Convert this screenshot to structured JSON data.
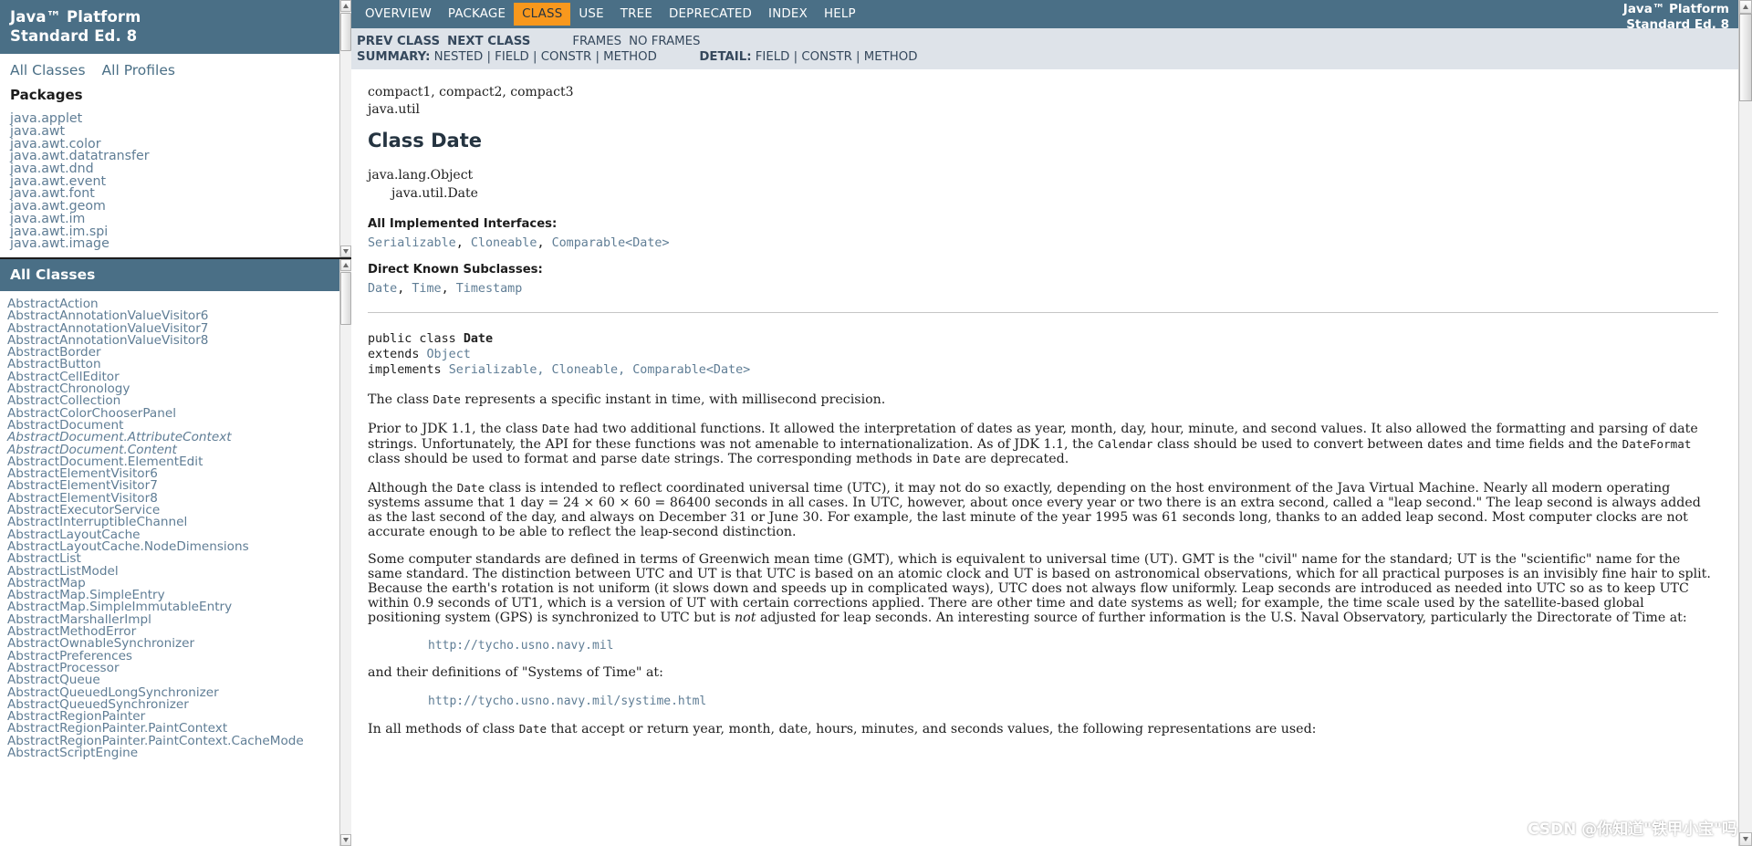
{
  "window": {
    "brand_line1": "Java™ Platform",
    "brand_line2": "Standard Ed. 8"
  },
  "package_frame": {
    "links": [
      {
        "label": "All Classes"
      },
      {
        "label": "All Profiles"
      }
    ],
    "section_title": "Packages",
    "packages": [
      "java.applet",
      "java.awt",
      "java.awt.color",
      "java.awt.datatransfer",
      "java.awt.dnd",
      "java.awt.event",
      "java.awt.font",
      "java.awt.geom",
      "java.awt.im",
      "java.awt.im.spi",
      "java.awt.image"
    ]
  },
  "class_frame": {
    "header": "All Classes",
    "classes": [
      {
        "name": "AbstractAction",
        "interface": false
      },
      {
        "name": "AbstractAnnotationValueVisitor6",
        "interface": false
      },
      {
        "name": "AbstractAnnotationValueVisitor7",
        "interface": false
      },
      {
        "name": "AbstractAnnotationValueVisitor8",
        "interface": false
      },
      {
        "name": "AbstractBorder",
        "interface": false
      },
      {
        "name": "AbstractButton",
        "interface": false
      },
      {
        "name": "AbstractCellEditor",
        "interface": false
      },
      {
        "name": "AbstractChronology",
        "interface": false
      },
      {
        "name": "AbstractCollection",
        "interface": false
      },
      {
        "name": "AbstractColorChooserPanel",
        "interface": false
      },
      {
        "name": "AbstractDocument",
        "interface": false
      },
      {
        "name": "AbstractDocument.AttributeContext",
        "interface": true
      },
      {
        "name": "AbstractDocument.Content",
        "interface": true
      },
      {
        "name": "AbstractDocument.ElementEdit",
        "interface": false
      },
      {
        "name": "AbstractElementVisitor6",
        "interface": false
      },
      {
        "name": "AbstractElementVisitor7",
        "interface": false
      },
      {
        "name": "AbstractElementVisitor8",
        "interface": false
      },
      {
        "name": "AbstractExecutorService",
        "interface": false
      },
      {
        "name": "AbstractInterruptibleChannel",
        "interface": false
      },
      {
        "name": "AbstractLayoutCache",
        "interface": false
      },
      {
        "name": "AbstractLayoutCache.NodeDimensions",
        "interface": false
      },
      {
        "name": "AbstractList",
        "interface": false
      },
      {
        "name": "AbstractListModel",
        "interface": false
      },
      {
        "name": "AbstractMap",
        "interface": false
      },
      {
        "name": "AbstractMap.SimpleEntry",
        "interface": false
      },
      {
        "name": "AbstractMap.SimpleImmutableEntry",
        "interface": false
      },
      {
        "name": "AbstractMarshallerImpl",
        "interface": false
      },
      {
        "name": "AbstractMethodError",
        "interface": false
      },
      {
        "name": "AbstractOwnableSynchronizer",
        "interface": false
      },
      {
        "name": "AbstractPreferences",
        "interface": false
      },
      {
        "name": "AbstractProcessor",
        "interface": false
      },
      {
        "name": "AbstractQueue",
        "interface": false
      },
      {
        "name": "AbstractQueuedLongSynchronizer",
        "interface": false
      },
      {
        "name": "AbstractQueuedSynchronizer",
        "interface": false
      },
      {
        "name": "AbstractRegionPainter",
        "interface": false
      },
      {
        "name": "AbstractRegionPainter.PaintContext",
        "interface": false
      },
      {
        "name": "AbstractRegionPainter.PaintContext.CacheMode",
        "interface": false
      },
      {
        "name": "AbstractScriptEngine",
        "interface": false
      }
    ]
  },
  "topnav": {
    "items": [
      {
        "label": "OVERVIEW",
        "active": false
      },
      {
        "label": "PACKAGE",
        "active": false
      },
      {
        "label": "CLASS",
        "active": true
      },
      {
        "label": "USE",
        "active": false
      },
      {
        "label": "TREE",
        "active": false
      },
      {
        "label": "DEPRECATED",
        "active": false
      },
      {
        "label": "INDEX",
        "active": false
      },
      {
        "label": "HELP",
        "active": false
      }
    ],
    "about_line1": "Java™ Platform",
    "about_line2": "Standard Ed. 8",
    "active_color": "#f8981d",
    "bar_color": "#4a6f86"
  },
  "subnav": {
    "prev_class": "PREV CLASS",
    "next_class": "NEXT CLASS",
    "frames": "FRAMES",
    "no_frames": "NO FRAMES",
    "summary_label": "SUMMARY:",
    "summary_items": [
      "NESTED",
      "FIELD",
      "CONSTR",
      "METHOD"
    ],
    "detail_label": "DETAIL:",
    "detail_items": [
      "FIELD",
      "CONSTR",
      "METHOD"
    ],
    "separator": "|"
  },
  "content": {
    "profiles": "compact1, compact2, compact3",
    "package": "java.util",
    "title": "Class Date",
    "inheritance": [
      "java.lang.Object",
      "java.util.Date"
    ],
    "implemented_label": "All Implemented Interfaces:",
    "implemented": [
      "Serializable",
      "Cloneable",
      "Comparable<Date>"
    ],
    "subclasses_label": "Direct Known Subclasses:",
    "subclasses": [
      "Date",
      "Time",
      "Timestamp"
    ],
    "declaration": {
      "line1_kw": "public class",
      "line1_name": "Date",
      "line2_kw": "extends",
      "line2_type": "Object",
      "line3_kw": "implements",
      "line3_types": "Serializable, Cloneable, Comparable<Date>"
    },
    "paragraphs": [
      "The class Date represents a specific instant in time, with millisecond precision.",
      "Prior to JDK 1.1, the class Date had two additional functions. It allowed the interpretation of dates as year, month, day, hour, minute, and second values. It also allowed the formatting and parsing of date strings. Unfortunately, the API for these functions was not amenable to internationalization. As of JDK 1.1, the Calendar class should be used to convert between dates and time fields and the DateFormat class should be used to format and parse date strings. The corresponding methods in Date are deprecated.",
      "Although the Date class is intended to reflect coordinated universal time (UTC), it may not do so exactly, depending on the host environment of the Java Virtual Machine. Nearly all modern operating systems assume that 1 day = 24 × 60 × 60 = 86400 seconds in all cases. In UTC, however, about once every year or two there is an extra second, called a \"leap second.\" The leap second is always added as the last second of the day, and always on December 31 or June 30. For example, the last minute of the year 1995 was 61 seconds long, thanks to an added leap second. Most computer clocks are not accurate enough to be able to reflect the leap-second distinction.",
      "Some computer standards are defined in terms of Greenwich mean time (GMT), which is equivalent to universal time (UT). GMT is the \"civil\" name for the standard; UT is the \"scientific\" name for the same standard. The distinction between UTC and UT is that UTC is based on an atomic clock and UT is based on astronomical observations, which for all practical purposes is an invisibly fine hair to split. Because the earth's rotation is not uniform (it slows down and speeds up in complicated ways), UTC does not always flow uniformly. Leap seconds are introduced as needed into UTC so as to keep UTC within 0.9 seconds of UT1, which is a version of UT with certain corrections applied. There are other time and date systems as well; for example, the time scale used by the satellite-based global positioning system (GPS) is synchronized to UTC but is not adjusted for leap seconds. An interesting source of further information is the U.S. Naval Observatory, particularly the Directorate of Time at:",
      "and their definitions of \"Systems of Time\" at:",
      "In all methods of class Date that accept or return year, month, date, hours, minutes, and seconds values, the following representations are used:"
    ],
    "url1": "http://tycho.usno.navy.mil",
    "url2": "http://tycho.usno.navy.mil/systime.html",
    "para_after_text": "and their definitions of \"Systems of Time\" at:"
  },
  "watermark": "CSDN @你知道\"铁甲小宝\"吗"
}
